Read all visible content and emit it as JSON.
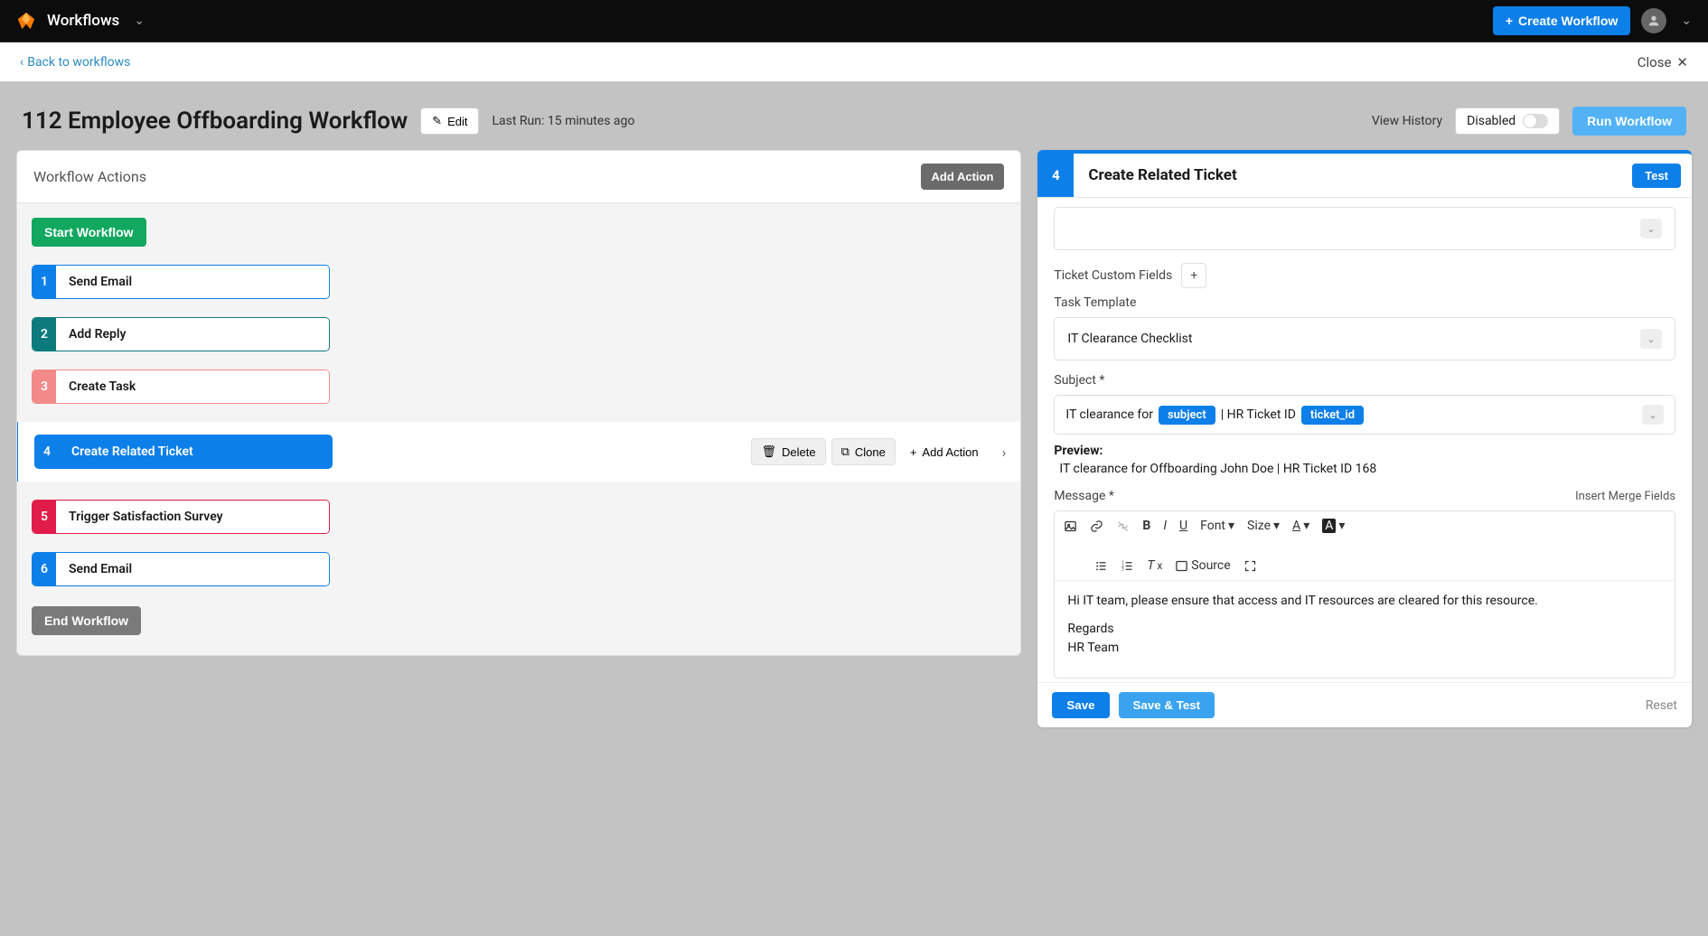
{
  "topbar": {
    "title": "Workflows",
    "create_btn": "Create Workflow"
  },
  "subbar": {
    "back": "Back to workflows",
    "close": "Close"
  },
  "header": {
    "title": "112 Employee Offboarding Workflow",
    "edit": "Edit",
    "lastrun": "Last Run: 15 minutes ago",
    "view_history": "View History",
    "disabled": "Disabled",
    "run": "Run Workflow"
  },
  "left": {
    "head": "Workflow Actions",
    "add_action": "Add Action",
    "start": "Start Workflow",
    "end": "End Workflow",
    "actions": [
      {
        "n": "1",
        "label": "Send Email"
      },
      {
        "n": "2",
        "label": "Add Reply"
      },
      {
        "n": "3",
        "label": "Create Task"
      },
      {
        "n": "4",
        "label": "Create Related Ticket"
      },
      {
        "n": "5",
        "label": "Trigger Satisfaction Survey"
      },
      {
        "n": "6",
        "label": "Send Email"
      }
    ],
    "row_btns": {
      "delete": "Delete",
      "clone": "Clone",
      "add": "Add Action"
    }
  },
  "right": {
    "num": "4",
    "title": "Create Related Ticket",
    "test": "Test",
    "fields": {
      "custom_fields": "Ticket Custom Fields",
      "task_template": "Task Template",
      "task_template_value": "IT Clearance Checklist",
      "subject": "Subject *",
      "subject_parts": {
        "pre": "IT clearance for",
        "tok1": "subject",
        "mid": "| HR Ticket ID",
        "tok2": "ticket_id"
      },
      "preview_label": "Preview:",
      "preview_value": "IT clearance for Offboarding John Doe | HR Ticket ID 168",
      "message": "Message *",
      "insert_merge": "Insert Merge Fields"
    },
    "editor": {
      "font": "Font",
      "size": "Size",
      "source": "Source",
      "body_line1": "Hi IT team, please ensure that access and IT resources are cleared for this resource.",
      "body_line2": "Regards",
      "body_line3": "HR Team"
    },
    "foot": {
      "save": "Save",
      "save_test": "Save & Test",
      "reset": "Reset"
    }
  }
}
